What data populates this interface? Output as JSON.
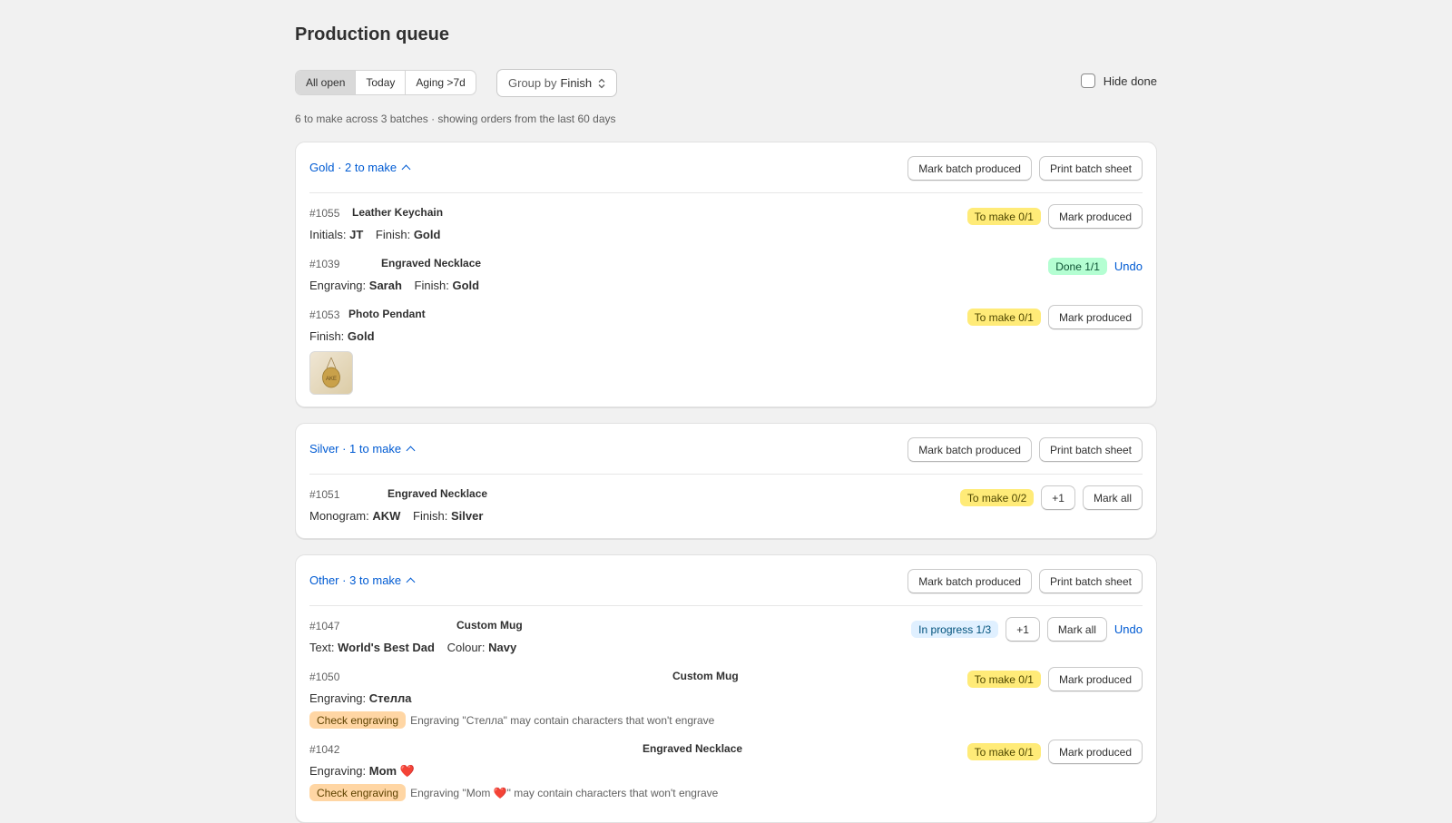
{
  "page": {
    "title": "Production queue",
    "filters": [
      "All open",
      "Today",
      "Aging >7d"
    ],
    "active_filter": "All open",
    "group_by": {
      "label": "Group by",
      "value": "Finish"
    },
    "hide_done_label": "Hide done",
    "hide_done_checked": false,
    "summary": "6 to make across 3 batches · showing orders from the last 60 days"
  },
  "labels": {
    "mark_batch_produced": "Mark batch produced",
    "print_batch_sheet": "Print batch sheet",
    "mark_produced": "Mark produced",
    "mark_all": "Mark all",
    "plus_one": "+1",
    "undo": "Undo",
    "check_engraving": "Check engraving"
  },
  "groups": [
    {
      "title": "Gold · 2 to make",
      "rows": [
        {
          "order": "#1055",
          "product": "Leather Keychain",
          "attrs": [
            [
              "Initials:",
              "JT"
            ],
            [
              "Finish:",
              "Gold"
            ]
          ],
          "status": "To make 0/1",
          "status_type": "make",
          "actions": [
            "mark_produced"
          ]
        },
        {
          "order": "#1039",
          "product": "Engraved Necklace",
          "attrs": [
            [
              "Engraving:",
              "Sarah"
            ],
            [
              "Finish:",
              "Gold"
            ]
          ],
          "status": "Done 1/1",
          "status_type": "done",
          "actions": [
            "undo"
          ]
        },
        {
          "order": "#1053",
          "product": "Photo Pendant",
          "attrs": [
            [
              "Finish:",
              "Gold"
            ]
          ],
          "status": "To make 0/1",
          "status_type": "make",
          "actions": [
            "mark_produced"
          ],
          "thumb_text": "AKE"
        }
      ]
    },
    {
      "title": "Silver · 1 to make",
      "rows": [
        {
          "order": "#1051",
          "product": "Engraved Necklace",
          "attrs": [
            [
              "Monogram:",
              "AKW"
            ],
            [
              "Finish:",
              "Silver"
            ]
          ],
          "status": "To make 0/2",
          "status_type": "make",
          "actions": [
            "plus_one",
            "mark_all"
          ]
        }
      ]
    },
    {
      "title": "Other · 3 to make",
      "rows": [
        {
          "order": "#1047",
          "product": "Custom Mug",
          "attrs": [
            [
              "Text:",
              "World's Best Dad"
            ],
            [
              "Colour:",
              "Navy"
            ]
          ],
          "status": "In progress 1/3",
          "status_type": "prog",
          "actions": [
            "plus_one",
            "mark_all",
            "undo"
          ]
        },
        {
          "order": "#1050",
          "product": "Custom Mug",
          "attrs": [
            [
              "Engraving:",
              "Стелла"
            ]
          ],
          "status": "To make 0/1",
          "status_type": "make",
          "actions": [
            "mark_produced"
          ],
          "warning": "Engraving \"Стелла\" may contain characters that won't engrave"
        },
        {
          "order": "#1042",
          "product": "Engraved Necklace",
          "attrs": [
            [
              "Engraving:",
              "Mom ❤️"
            ]
          ],
          "status": "To make 0/1",
          "status_type": "make",
          "actions": [
            "mark_produced"
          ],
          "warning": "Engraving \"Mom ❤️\" may contain characters that won't engrave"
        }
      ]
    }
  ]
}
